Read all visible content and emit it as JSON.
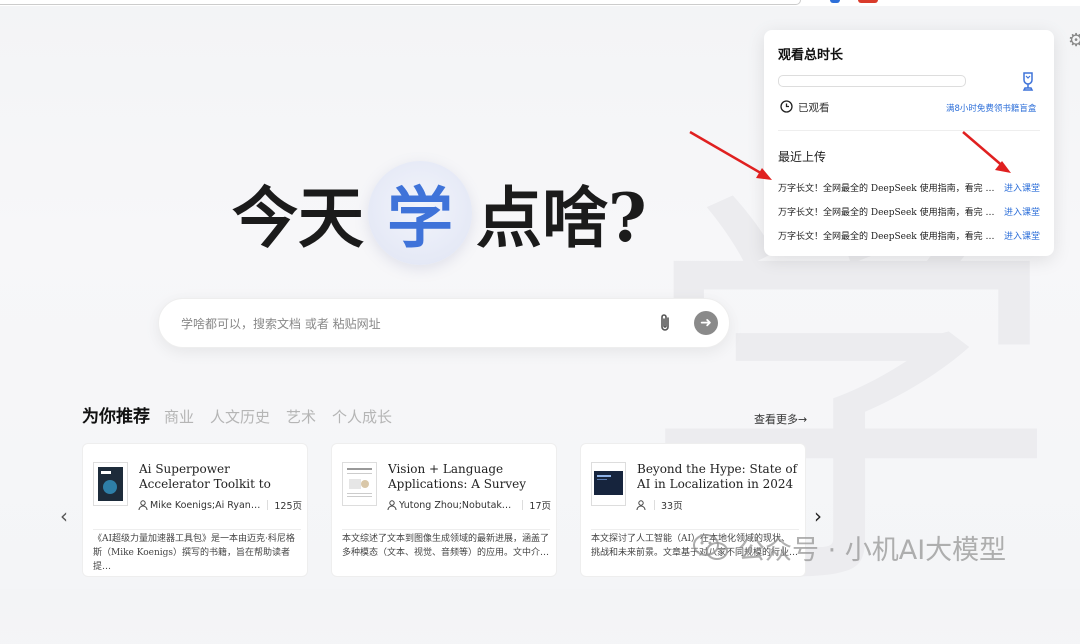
{
  "hero": {
    "before": "今天",
    "highlight": "学",
    "after": "点啥?"
  },
  "search": {
    "placeholder": "学啥都可以，搜索文档 或者 粘贴网址"
  },
  "recommend": {
    "title": "为你推荐",
    "tabs": [
      "商业",
      "人文历史",
      "艺术",
      "个人成长"
    ],
    "see_more": "查看更多→",
    "cards": [
      {
        "title": "Ai Superpower Accelerator Toolkit to Multiply Your…",
        "authors": "Mike Koenigs;Ai Ryan …",
        "pages": "125页",
        "desc": "《AI超级力量加速器工具包》是一本由迈克·科尼格斯（Mike Koenigs）撰写的书籍，旨在帮助读者提…"
      },
      {
        "title": "Vision + Language Applications: A Survey",
        "authors": "Yutong Zhou;Nobutaka S…",
        "pages": "17页",
        "desc": "本文综述了文本到图像生成领域的最新进展，涵盖了多种模态（文本、视觉、音频等）的应用。文中介…"
      },
      {
        "title": "Beyond the Hype: State of AI in Localization in 2024",
        "authors": "",
        "pages": "33页",
        "desc": "本文探讨了人工智能（AI）在本地化领域的现状、挑战和未来前景。文章基于对八家不同规模的行业…"
      }
    ]
  },
  "panel": {
    "title": "观看总时长",
    "progress": 0.0,
    "watched_label": "已观看",
    "bonus_link": "满8小时免费领书籍盲盒",
    "recent_title": "最近上传",
    "uploads": [
      {
        "title": "万字长文！全网最全的 DeepSeek 使用指南，看完 De…",
        "link": "进入课堂"
      },
      {
        "title": "万字长文！全网最全的 DeepSeek 使用指南，看完 De…",
        "link": "进入课堂"
      },
      {
        "title": "万字长文！全网最全的 DeepSeek 使用指南，看完 De…",
        "link": "进入课堂"
      }
    ]
  },
  "watermark": {
    "text": "公众号 · 小机AI大模型"
  },
  "colors": {
    "accent": "#3f73d9",
    "link": "#2d6fd9",
    "annotation": "#e02020"
  }
}
